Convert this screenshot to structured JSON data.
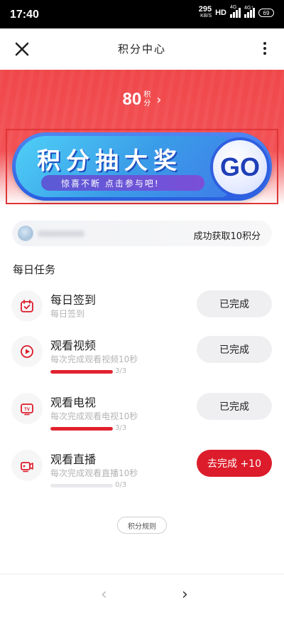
{
  "status_bar": {
    "time": "17:40",
    "net_speed": "295",
    "net_unit": "KB/S",
    "hd": "HD",
    "signal_1": "4G",
    "signal_2": "4G⁺",
    "battery": "69"
  },
  "header": {
    "title": "积分中心",
    "close_icon": "close-icon",
    "more_icon": "more-vertical-icon"
  },
  "banner": {
    "points_value": "80",
    "points_unit_top": "积",
    "points_unit_bottom": "分",
    "chevron": "›",
    "lottery_title": "积分抽大奖",
    "lottery_subtitle": "惊喜不断 点击参与吧!",
    "go_label": "GO",
    "colors": {
      "banner_red": "#f0474a",
      "lottery_blue": "#2f5fe0",
      "go_text": "#1f3fb8"
    }
  },
  "notice": {
    "text": "成功获取10积分"
  },
  "daily_tasks": {
    "title": "每日任务",
    "items": [
      {
        "name": "每日签到",
        "desc": "每日签到",
        "icon": "calendar-check-icon",
        "button": "已完成",
        "status": "done",
        "progress_text": "",
        "progress": null
      },
      {
        "name": "观看视频",
        "desc": "每次完成观看视频10秒",
        "icon": "play-circle-icon",
        "button": "已完成",
        "status": "done",
        "progress_text": "3/3",
        "progress": 1.0
      },
      {
        "name": "观看电视",
        "desc": "每次完成观看电视10秒",
        "icon": "tv-icon",
        "button": "已完成",
        "status": "done",
        "progress_text": "3/3",
        "progress": 1.0
      },
      {
        "name": "观看直播",
        "desc": "每次完成观看直播10秒",
        "icon": "live-camera-icon",
        "button": "去完成 +10",
        "status": "todo",
        "progress_text": "0/3",
        "progress": 0.0
      }
    ],
    "accent": "#dc1c2a"
  },
  "rules_button": "积分规则",
  "bottom_nav": {
    "back": "‹",
    "forward": "›"
  }
}
